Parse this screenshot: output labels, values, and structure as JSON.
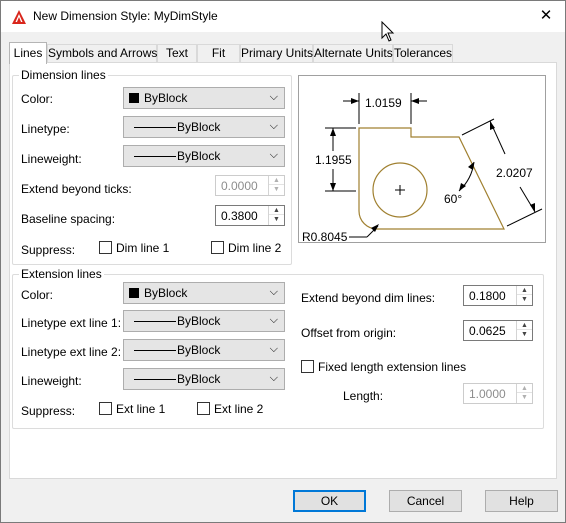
{
  "window": {
    "title": "New Dimension Style: MyDimStyle",
    "close_label": "✕"
  },
  "tabs": [
    {
      "label": "Lines"
    },
    {
      "label": "Symbols and Arrows"
    },
    {
      "label": "Text"
    },
    {
      "label": "Fit"
    },
    {
      "label": "Primary Units"
    },
    {
      "label": "Alternate Units"
    },
    {
      "label": "Tolerances"
    }
  ],
  "dimension_lines": {
    "title": "Dimension lines",
    "color_label": "Color:",
    "color_value": "ByBlock",
    "linetype_label": "Linetype:",
    "linetype_value": "ByBlock",
    "lineweight_label": "Lineweight:",
    "lineweight_value": "ByBlock",
    "extend_label": "Extend beyond ticks:",
    "extend_value": "0.0000",
    "baseline_label": "Baseline spacing:",
    "baseline_value": "0.3800",
    "suppress_label": "Suppress:",
    "dim_line_1": "Dim line 1",
    "dim_line_2": "Dim line 2"
  },
  "extension_lines": {
    "title": "Extension lines",
    "color_label": "Color:",
    "color_value": "ByBlock",
    "linetype1_label": "Linetype ext line 1:",
    "linetype1_value": "ByBlock",
    "linetype2_label": "Linetype ext line 2:",
    "linetype2_value": "ByBlock",
    "lineweight_label": "Lineweight:",
    "lineweight_value": "ByBlock",
    "suppress_label": "Suppress:",
    "ext_line_1": "Ext line 1",
    "ext_line_2": "Ext line 2",
    "extend_beyond_label": "Extend beyond dim lines:",
    "extend_beyond_value": "0.1800",
    "offset_label": "Offset from origin:",
    "offset_value": "0.0625",
    "fixed_length_label": "Fixed length extension lines",
    "length_label": "Length:",
    "length_value": "1.0000"
  },
  "preview": {
    "dim_top": "1.0159",
    "dim_left": "1.1955",
    "dim_right": "2.0207",
    "angle": "60°",
    "radius": "R0.8045",
    "shape_color": "#a08030"
  },
  "buttons": {
    "ok": "OK",
    "cancel": "Cancel",
    "help": "Help"
  },
  "colors": {
    "accent": "#0078d7",
    "app_icon": "#d9261c"
  }
}
